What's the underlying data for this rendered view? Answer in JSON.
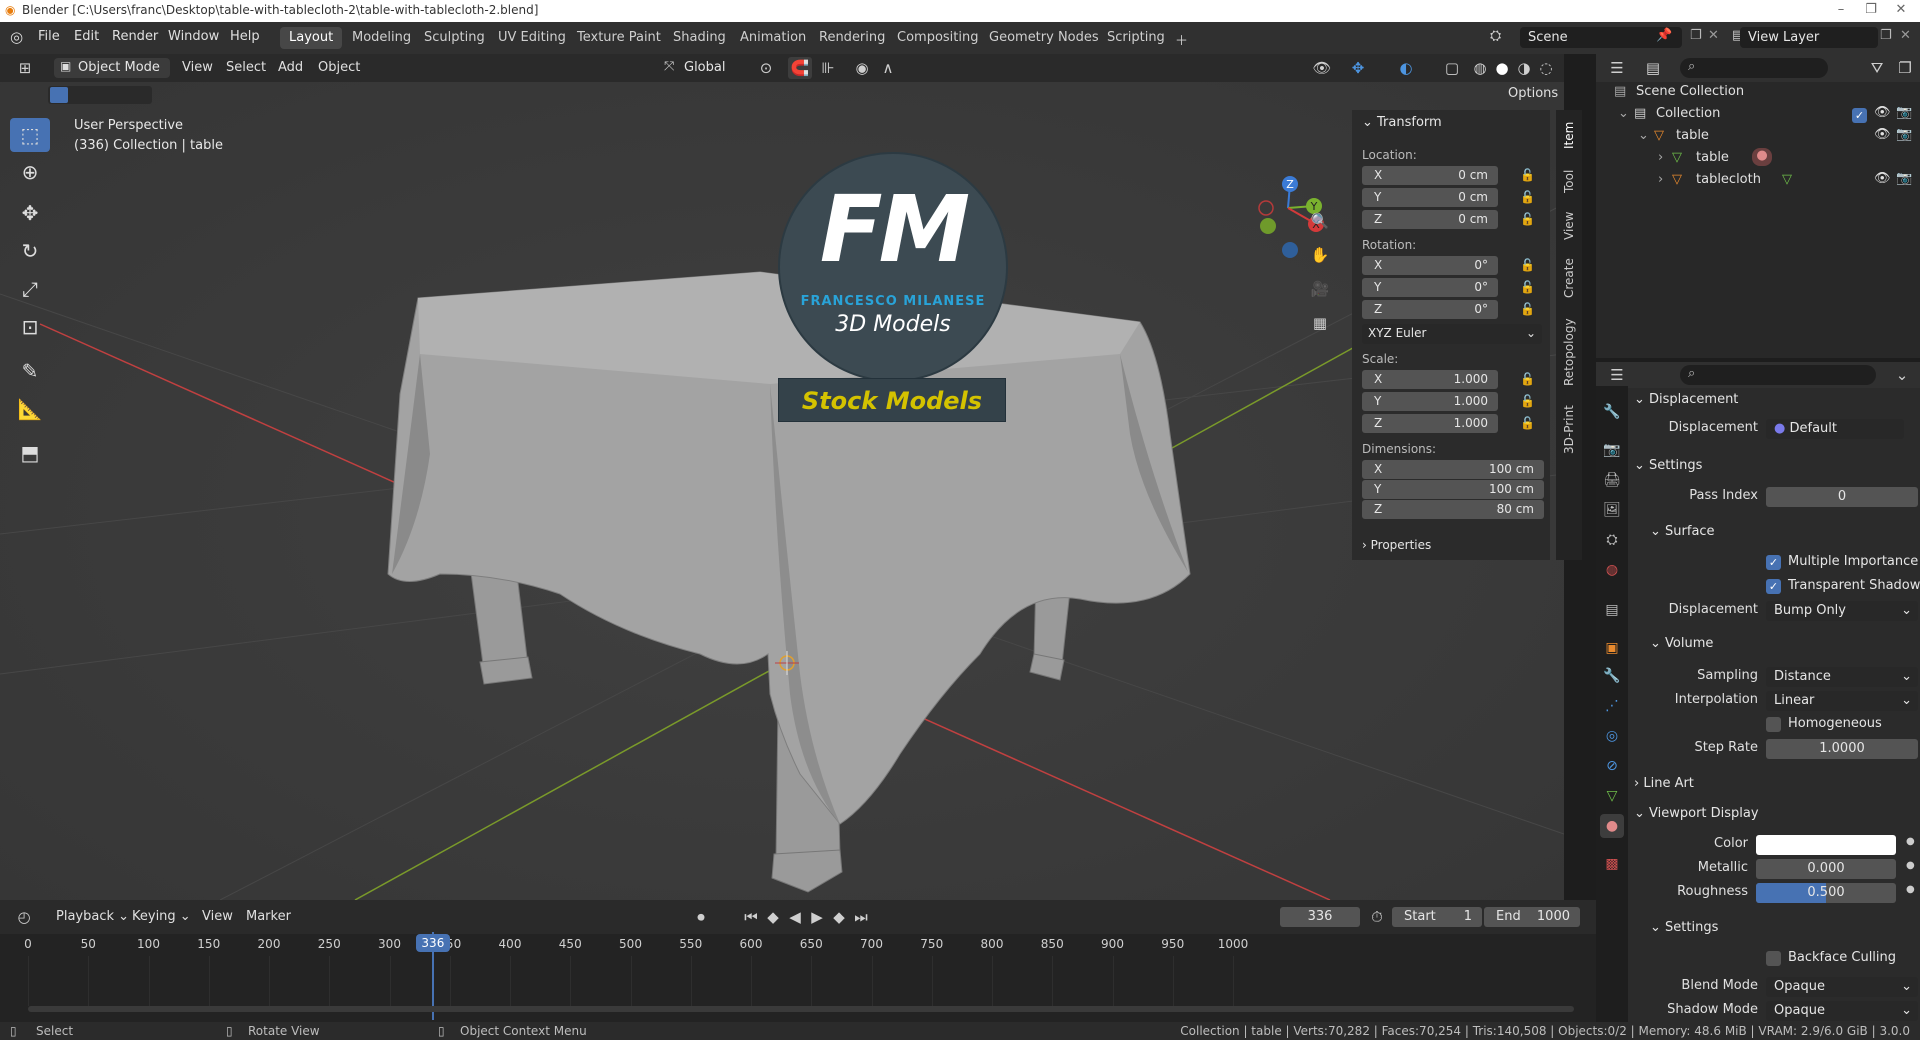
{
  "window": {
    "title": "Blender [C:\\Users\\franc\\Desktop\\table-with-tablecloth-2\\table-with-tablecloth-2.blend]"
  },
  "menu": [
    "File",
    "Edit",
    "Render",
    "Window",
    "Help"
  ],
  "workspaces": [
    "Layout",
    "Modeling",
    "Sculpting",
    "UV Editing",
    "Texture Paint",
    "Shading",
    "Animation",
    "Rendering",
    "Compositing",
    "Geometry Nodes",
    "Scripting"
  ],
  "scene": {
    "name": "Scene",
    "view_layer": "View Layer"
  },
  "viewport_header": {
    "mode": "Object Mode",
    "view": "View",
    "select": "Select",
    "add": "Add",
    "object": "Object",
    "orientation": "Global",
    "options": "Options"
  },
  "viewport": {
    "perspective": "User Perspective",
    "collection_info": "(336) Collection | table"
  },
  "watermark": {
    "initials": "FM",
    "author": "FRANCESCO MILANESE",
    "subtitle": "3D Models",
    "banner": "Stock Models"
  },
  "gizmo": {
    "x": "X",
    "y": "Y",
    "z": "Z"
  },
  "npanel": {
    "header": "Transform",
    "location_label": "Location:",
    "location": [
      {
        "axis": "X",
        "value": "0 cm"
      },
      {
        "axis": "Y",
        "value": "0 cm"
      },
      {
        "axis": "Z",
        "value": "0 cm"
      }
    ],
    "rotation_label": "Rotation:",
    "rotation": [
      {
        "axis": "X",
        "value": "0°"
      },
      {
        "axis": "Y",
        "value": "0°"
      },
      {
        "axis": "Z",
        "value": "0°"
      }
    ],
    "rotation_mode": "XYZ Euler",
    "scale_label": "Scale:",
    "scale": [
      {
        "axis": "X",
        "value": "1.000"
      },
      {
        "axis": "Y",
        "value": "1.000"
      },
      {
        "axis": "Z",
        "value": "1.000"
      }
    ],
    "dimensions_label": "Dimensions:",
    "dimensions": [
      {
        "axis": "X",
        "value": "100 cm"
      },
      {
        "axis": "Y",
        "value": "100 cm"
      },
      {
        "axis": "Z",
        "value": "80 cm"
      }
    ],
    "properties": "Properties",
    "tabs": [
      "Item",
      "Tool",
      "View",
      "Create",
      "Retopology",
      "3D-Print"
    ]
  },
  "outliner": {
    "scene_collection": "Scene Collection",
    "collection": "Collection",
    "items": [
      "table",
      "table",
      "tablecloth"
    ]
  },
  "properties": {
    "displacement_section": "Displacement",
    "displacement_label": "Displacement",
    "displacement_value": "Default",
    "settings": "Settings",
    "pass_index_label": "Pass Index",
    "pass_index": "0",
    "surface": "Surface",
    "multiple_importance": "Multiple Importance",
    "transparent_shadows": "Transparent Shadows",
    "surface_displacement_label": "Displacement",
    "surface_displacement": "Bump Only",
    "volume": "Volume",
    "sampling_label": "Sampling",
    "sampling": "Distance",
    "interpolation_label": "Interpolation",
    "interpolation": "Linear",
    "homogeneous": "Homogeneous",
    "step_rate_label": "Step Rate",
    "step_rate": "1.0000",
    "line_art": "Line Art",
    "viewport_display": "Viewport Display",
    "color_label": "Color",
    "metallic_label": "Metallic",
    "metallic": "0.000",
    "roughness_label": "Roughness",
    "roughness": "0.500",
    "roughness_fraction": 0.5,
    "settings2": "Settings",
    "backface_culling": "Backface Culling",
    "blend_mode_label": "Blend Mode",
    "blend_mode": "Opaque",
    "shadow_mode_label": "Shadow Mode",
    "shadow_mode": "Opaque"
  },
  "timeline": {
    "menus": [
      "Playback",
      "Keying",
      "View",
      "Marker"
    ],
    "current_frame": "336",
    "start_label": "Start",
    "start": "1",
    "end_label": "End",
    "end": "1000",
    "ticks": [
      "0",
      "50",
      "100",
      "150",
      "200",
      "250",
      "300",
      "336",
      "350",
      "400",
      "450",
      "500",
      "550",
      "600",
      "650",
      "700",
      "750",
      "800",
      "850",
      "900",
      "950",
      "1000"
    ]
  },
  "status": {
    "select": "Select",
    "rotate": "Rotate View",
    "context": "Object Context Menu",
    "stats": "Collection | table | Verts:70,282 | Faces:70,254 | Tris:140,508 | Objects:0/2 | Memory: 48.6 MiB | VRAM: 2.9/6.0 GiB | 3.0.0"
  },
  "colors": {
    "accent": "#4772b3",
    "viewport_bg": "#3c3c3c",
    "axis_x": "#c04040",
    "axis_y": "#7a9a2a",
    "fm_blue": "#29a3d8",
    "banner_text": "#d4c200"
  }
}
